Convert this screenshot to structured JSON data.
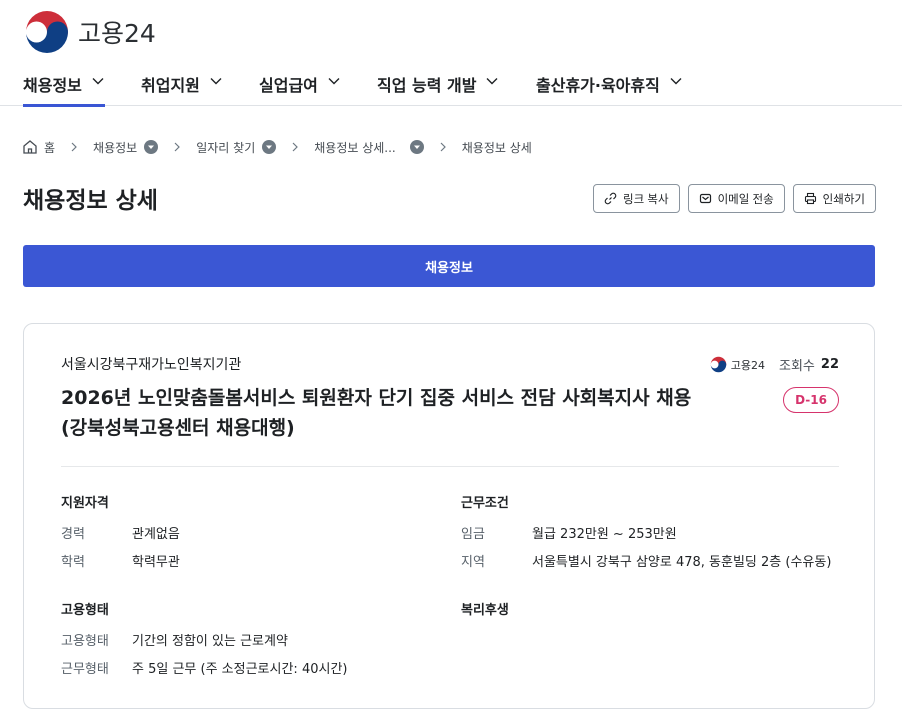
{
  "brand": {
    "logo_text": "고용24"
  },
  "gnb": {
    "items": [
      {
        "label": "채용정보"
      },
      {
        "label": "취업지원"
      },
      {
        "label": "실업급여"
      },
      {
        "label": "직업 능력 개발"
      },
      {
        "label": "출산휴가·육아휴직"
      }
    ],
    "active_index": 0
  },
  "breadcrumb": {
    "home": "홈",
    "items": [
      {
        "label": "채용정보"
      },
      {
        "label": "일자리 찾기"
      },
      {
        "label": "채용정보 상세..."
      },
      {
        "label": "채용정보 상세"
      }
    ]
  },
  "page": {
    "title": "채용정보 상세",
    "actions": {
      "copy_link": "링크 복사",
      "email": "이메일 전송",
      "print": "인쇄하기"
    },
    "tab_label": "채용정보"
  },
  "job": {
    "company": "서울시강북구재가노인복지기관",
    "source_logo": "고용24",
    "views_label": "조회수",
    "views_count": "22",
    "title": "2026년 노인맞춤돌봄서비스 퇴원환자 단기 집중 서비스 전담 사회복지사 채용(강북성북고용센터 채용대행)",
    "dday": "D-16",
    "qualification": {
      "title": "지원자격",
      "rows": [
        {
          "k": "경력",
          "v": "관계없음"
        },
        {
          "k": "학력",
          "v": "학력무관"
        }
      ]
    },
    "conditions": {
      "title": "근무조건",
      "rows": [
        {
          "k": "임금",
          "v": "월급 232만원 ~ 253만원"
        },
        {
          "k": "지역",
          "v": "서울특별시 강북구 삼양로 478, 동훈빌딩 2층 (수유동)"
        }
      ]
    },
    "employment": {
      "title": "고용형태",
      "rows": [
        {
          "k": "고용형태",
          "v": "기간의 정함이 있는 근로계약"
        },
        {
          "k": "근무형태",
          "v": "주 5일 근무 (주 소정근로시간: 40시간)"
        }
      ]
    },
    "welfare": {
      "title": "복리후생"
    }
  },
  "colors": {
    "primary": "#3b57d4",
    "dday": "#d6336c"
  }
}
